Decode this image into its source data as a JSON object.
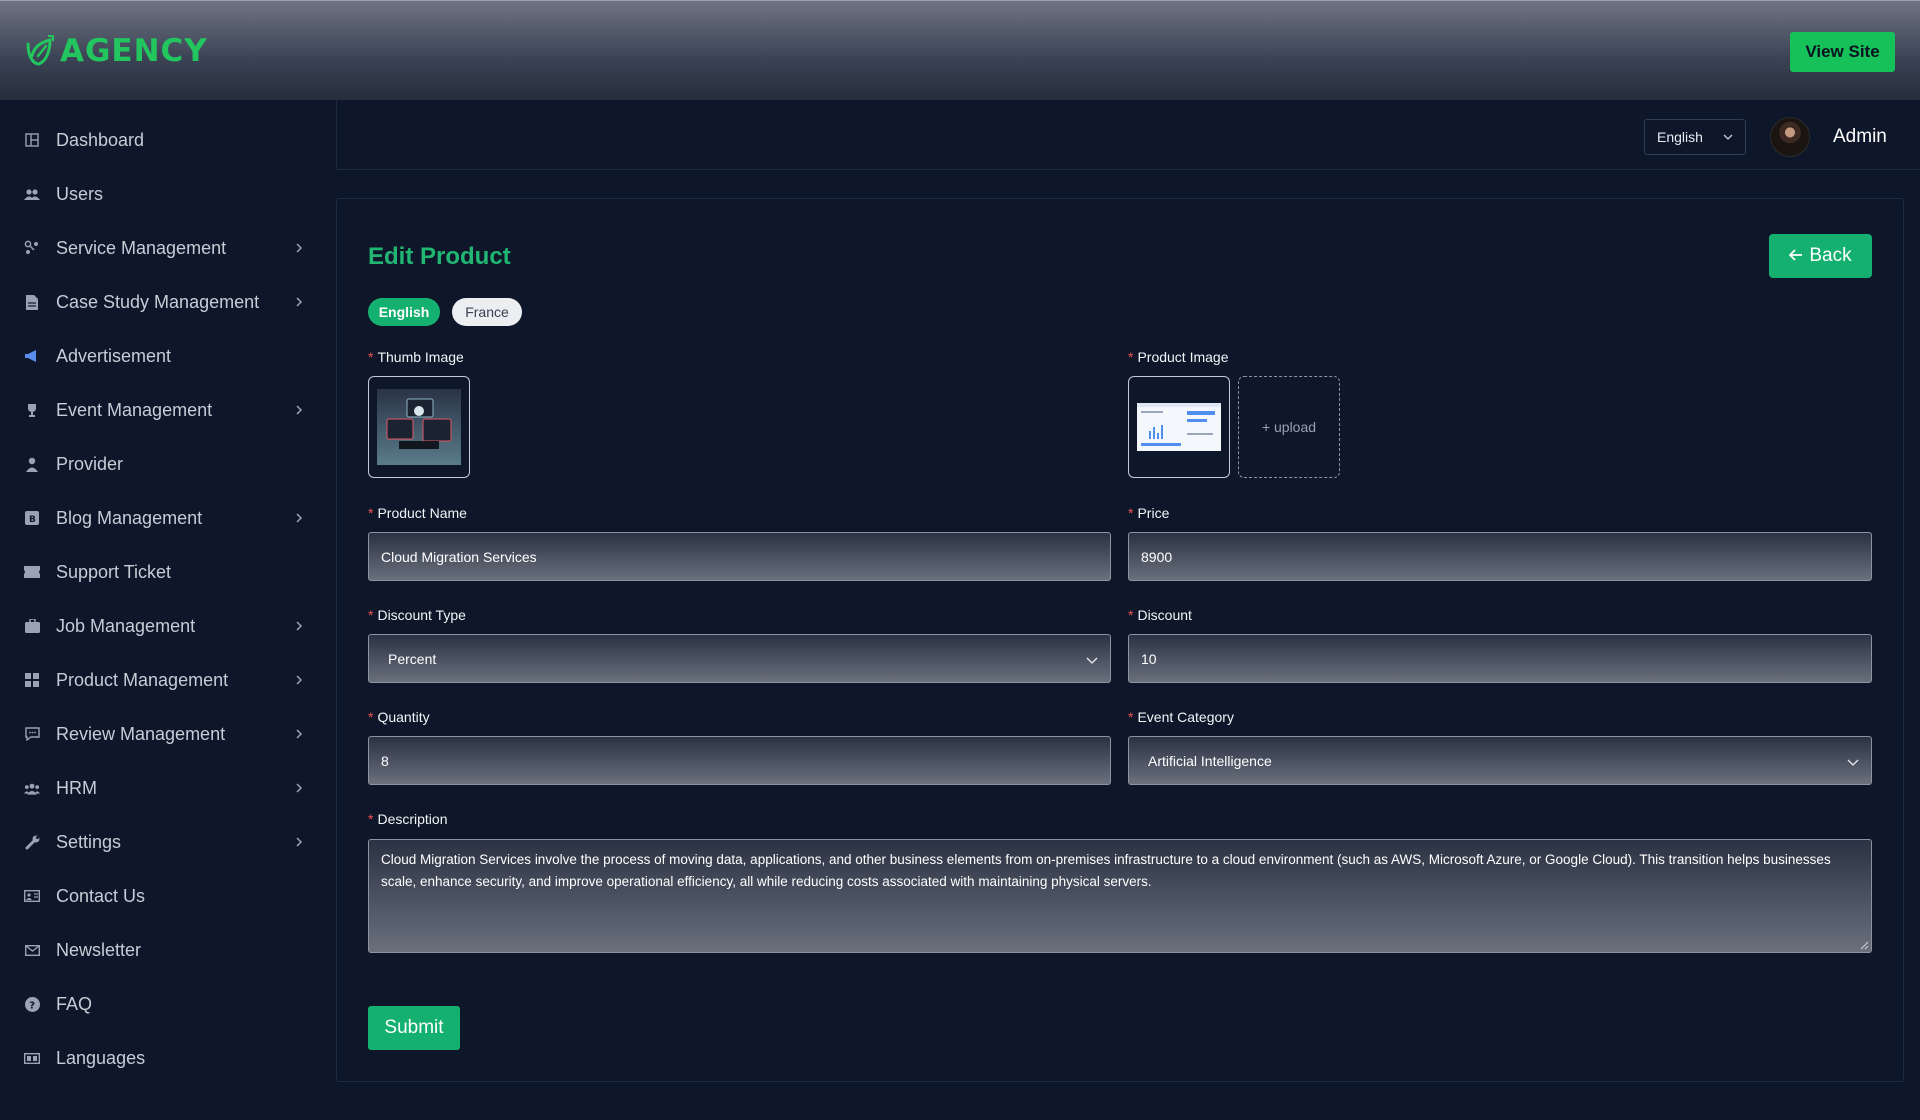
{
  "header": {
    "brand": "AGENCY",
    "view_site_label": "View Site",
    "brand_color": "#22c55e"
  },
  "sidebar": {
    "items": [
      {
        "label": "Dashboard",
        "icon": "dashboard-icon",
        "has_submenu": false
      },
      {
        "label": "Users",
        "icon": "users-icon",
        "has_submenu": false
      },
      {
        "label": "Service Management",
        "icon": "services-icon",
        "has_submenu": true
      },
      {
        "label": "Case Study Management",
        "icon": "document-icon",
        "has_submenu": true
      },
      {
        "label": "Advertisement",
        "icon": "megaphone-icon",
        "has_submenu": false
      },
      {
        "label": "Event Management",
        "icon": "trophy-icon",
        "has_submenu": true
      },
      {
        "label": "Provider",
        "icon": "person-icon",
        "has_submenu": false
      },
      {
        "label": "Blog Management",
        "icon": "blog-icon",
        "has_submenu": true
      },
      {
        "label": "Support Ticket",
        "icon": "ticket-icon",
        "has_submenu": false
      },
      {
        "label": "Job Management",
        "icon": "briefcase-icon",
        "has_submenu": true
      },
      {
        "label": "Product Management",
        "icon": "grid-icon",
        "has_submenu": true
      },
      {
        "label": "Review Management",
        "icon": "review-icon",
        "has_submenu": true
      },
      {
        "label": "HRM",
        "icon": "team-icon",
        "has_submenu": true
      },
      {
        "label": "Settings",
        "icon": "wrench-icon",
        "has_submenu": true
      },
      {
        "label": "Contact Us",
        "icon": "contact-card-icon",
        "has_submenu": false
      },
      {
        "label": "Newsletter",
        "icon": "envelope-icon",
        "has_submenu": false
      },
      {
        "label": "FAQ",
        "icon": "question-icon",
        "has_submenu": false
      },
      {
        "label": "Languages",
        "icon": "language-icon",
        "has_submenu": false
      }
    ]
  },
  "topnav": {
    "language": "English",
    "user_name": "Admin"
  },
  "form": {
    "title": "Edit Product",
    "back_label": "Back",
    "languages": [
      "English",
      "France"
    ],
    "thumb_image_label": "Thumb Image",
    "product_image_label": "Product Image",
    "upload_label": "+ upload",
    "product_name_label": "Product Name",
    "product_name_value": "Cloud Migration Services",
    "price_label": "Price",
    "price_value": "8900",
    "discount_type_label": "Discount Type",
    "discount_type_value": "Percent",
    "discount_label": "Discount",
    "discount_value": "10",
    "quantity_label": "Quantity",
    "quantity_value": "8",
    "event_category_label": "Event Category",
    "event_category_value": "Artificial Intelligence",
    "description_label": "Description",
    "description_value": "Cloud Migration Services involve the process of moving data, applications, and other business elements from on-premises infrastructure to a cloud environment (such as AWS, Microsoft Azure, or Google Cloud). This transition helps businesses scale, enhance security, and improve operational efficiency, all while reducing costs associated with maintaining physical servers.",
    "submit_label": "Submit",
    "accent_color": "#13b06f",
    "required_marker": "*"
  }
}
